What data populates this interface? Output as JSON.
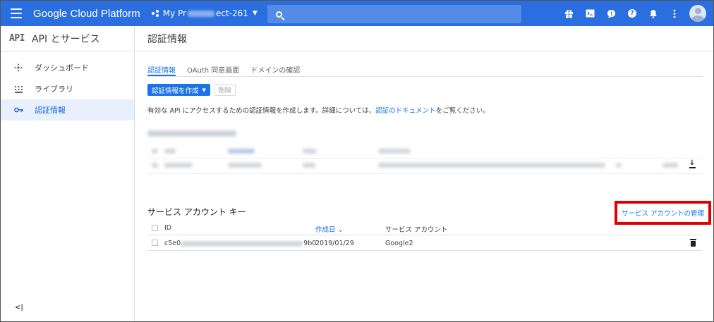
{
  "topbar": {
    "brand": "Google Cloud Platform",
    "project_prefix": "My Pr",
    "project_suffix": "ect-261",
    "icons": [
      "gift-icon",
      "cloud-shell-icon",
      "feedback-icon",
      "help-icon",
      "notifications-icon",
      "more-vert-icon",
      "account-avatar"
    ]
  },
  "sidebar": {
    "logo": "API",
    "title": "API とサービス",
    "items": [
      {
        "label": "ダッシュボード",
        "icon": "dashboard-icon"
      },
      {
        "label": "ライブラリ",
        "icon": "library-icon"
      },
      {
        "label": "認証情報",
        "icon": "key-icon",
        "active": true
      }
    ],
    "collapse": "<|"
  },
  "main": {
    "title": "認証情報",
    "tabs": [
      {
        "label": "認証情報",
        "active": true
      },
      {
        "label": "OAuth 同意画面"
      },
      {
        "label": "ドメインの確認"
      }
    ],
    "create_button": "認証情報を作成",
    "delete_button": "削除",
    "description_pre": "有効な API にアクセスするための認証情報を作成します。詳細については、",
    "description_link": "認証のドキュメント",
    "description_post": "をご覧ください。",
    "service_accounts": {
      "title": "サービス アカウント キー",
      "manage_link": "サービス アカウントの管理",
      "columns": {
        "id": "ID",
        "created": "作成日",
        "account": "サービス アカウント"
      },
      "rows": [
        {
          "id_start": "c5e0",
          "id_end": "9b0",
          "created": "2019/01/29",
          "account": "Google2"
        }
      ]
    }
  },
  "colors": {
    "topbar": "#2a6ee0",
    "accent": "#1a73e8",
    "highlight_box": "#e00000",
    "active_nav_bg": "#e8f0fe"
  }
}
